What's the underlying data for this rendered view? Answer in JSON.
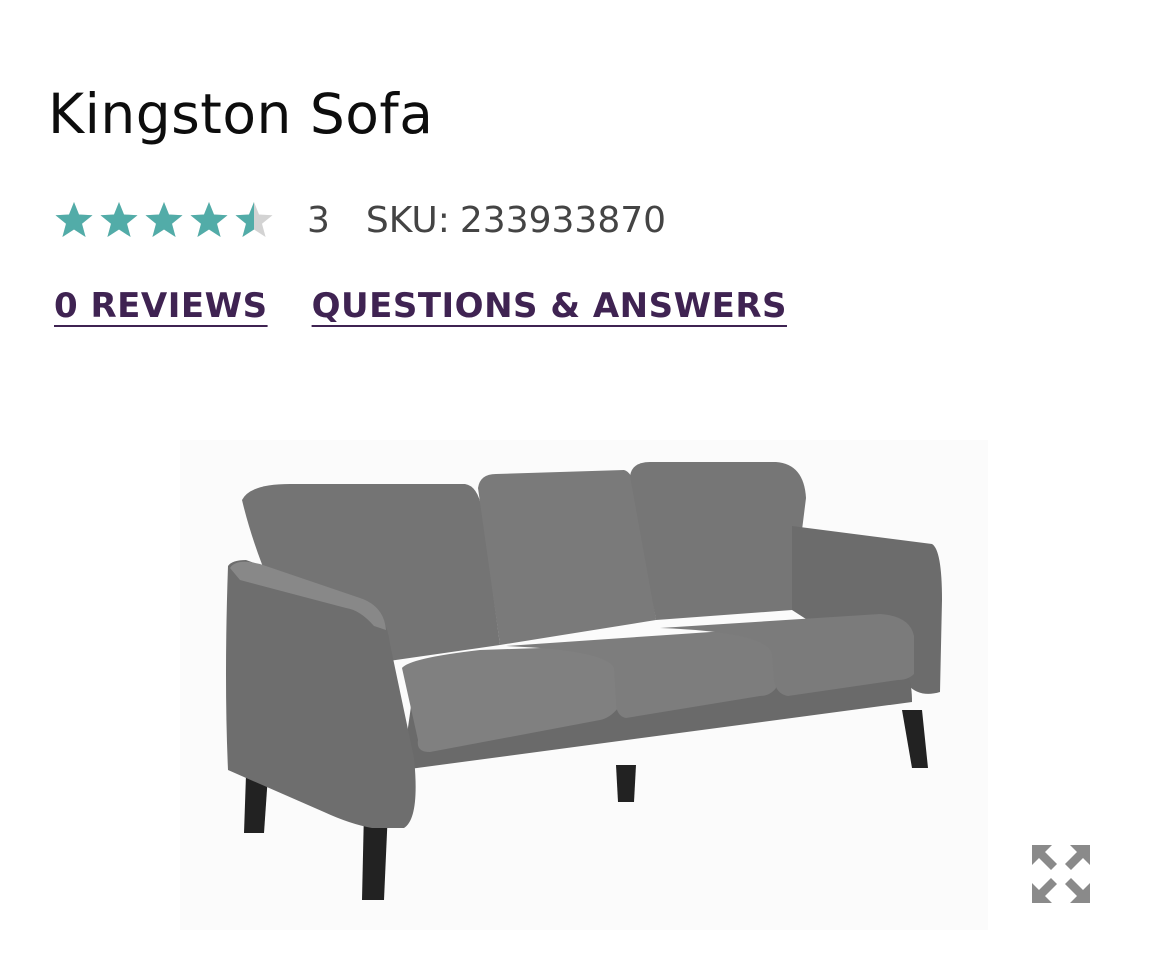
{
  "product": {
    "title": "Kingston Sofa",
    "rating": 4.5,
    "rating_max": 5,
    "rating_count": "3",
    "sku_label": "SKU:",
    "sku_value": "233933870"
  },
  "links": {
    "reviews": "0 REVIEWS",
    "qa": "QUESTIONS & ANSWERS"
  },
  "image": {
    "alt": "Gray velvet three-seat sofa",
    "icon": "expand-icon"
  },
  "colors": {
    "star_filled": "#52aca8",
    "star_empty": "#d3d3d3",
    "link": "#3f2352",
    "sofa": "#7a7a7a",
    "legs": "#222222"
  }
}
